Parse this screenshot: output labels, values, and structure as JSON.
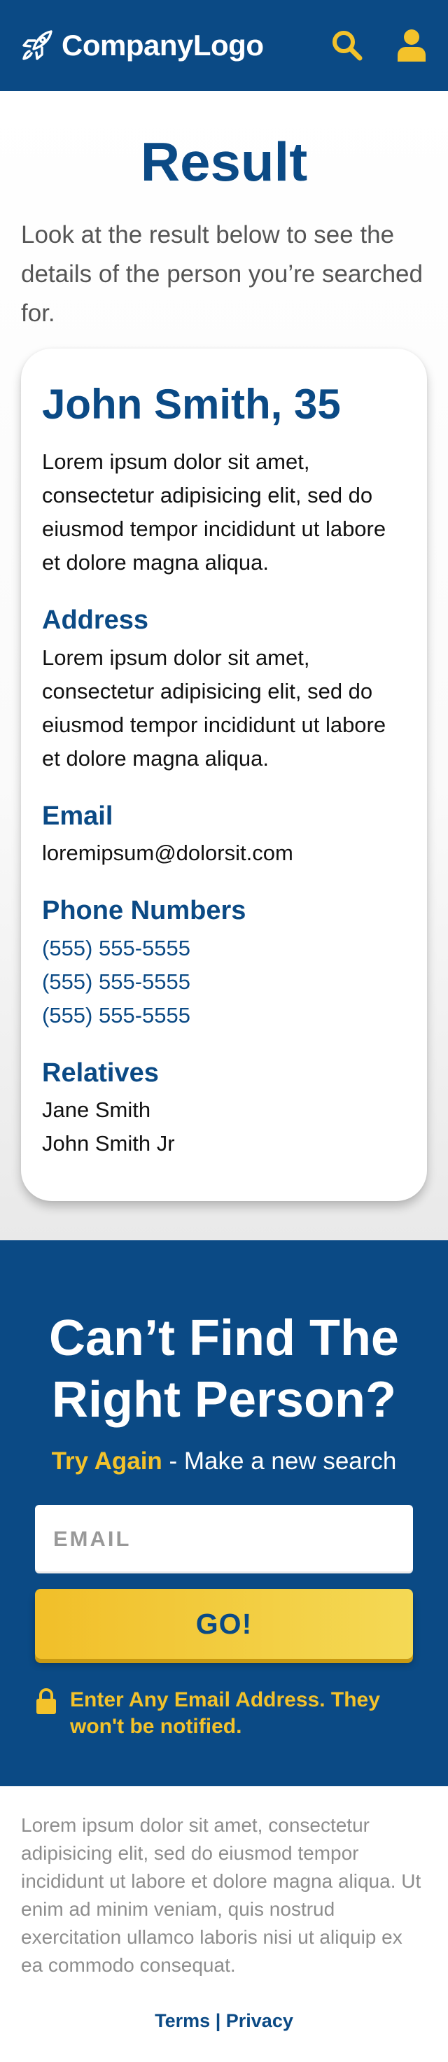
{
  "header": {
    "logo_text": "CompanyLogo",
    "logo_icon": "rocket-icon",
    "search_icon": "search-icon",
    "user_icon": "user-icon",
    "colors": {
      "background": "#0b4a85",
      "icon_accent": "#f3c22b"
    }
  },
  "result": {
    "title": "Result",
    "intro": "Look at the result below to see the details of the person you’re searched for.",
    "person": {
      "name": "John Smith, 35",
      "description": "Lorem ipsum dolor sit amet, consectetur adipisicing elit, sed do eiusmod tempor incididunt ut labore et dolore magna aliqua."
    },
    "address": {
      "heading": "Address",
      "text": "Lorem ipsum dolor sit amet, consectetur adipisicing elit, sed do eiusmod tempor incididunt ut labore et dolore magna aliqua."
    },
    "email": {
      "heading": "Email",
      "value": "loremipsum@dolorsit.com"
    },
    "phones": {
      "heading": "Phone Numbers",
      "items": [
        "(555) 555-5555",
        "(555) 555-5555",
        "(555) 555-5555"
      ]
    },
    "relatives": {
      "heading": "Relatives",
      "items": [
        "Jane Smith",
        "John Smith Jr"
      ]
    }
  },
  "cta": {
    "title": "Can’t Find The Right Person?",
    "try_again": "Try Again",
    "subtitle_rest": " - Make a new search",
    "email_placeholder": "EMAIL",
    "go_label": "GO!",
    "notice": "Enter Any Email Address. They won't be notified.",
    "lock_icon": "lock-icon"
  },
  "footer": {
    "text": "Lorem ipsum dolor sit amet, consectetur adipisicing elit, sed do eiusmod tempor incididunt ut labore et dolore magna aliqua. Ut enim ad minim veniam, quis nostrud exercitation ullamco laboris nisi ut aliquip ex ea commodo consequat.",
    "terms": "Terms",
    "separator": "|",
    "privacy": "Privacy"
  }
}
